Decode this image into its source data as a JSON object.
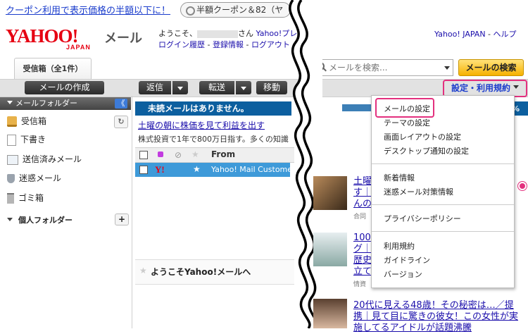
{
  "promo": {
    "link_text": "クーポン利用で表示価格の半額以下に！",
    "coupon_text": "半額クーポン＆82（ヤ"
  },
  "header": {
    "logo_text": "YAHOO!",
    "logo_sub": "JAPAN",
    "service_name": "メール",
    "welcome_prefix": "ようこそ、",
    "welcome_suffix": "さん",
    "yahoo_premium_link": "Yahoo!プレ",
    "login_history": "ログイン履歴",
    "registration_info": "登録情報",
    "logout": "ログアウト",
    "sep": " - ",
    "yahoo_japan_link": "Yahoo! JAPAN",
    "help_link": "ヘルプ"
  },
  "tab": {
    "label": "受信箱（全1件）"
  },
  "search": {
    "placeholder": "メールを検索...",
    "button_label": "メールの検索"
  },
  "toolbar": {
    "compose": "メールの作成",
    "reply": "返信",
    "forward": "転送",
    "move": "移動",
    "settings": "設定・利用規約"
  },
  "sidebar": {
    "header": "メールフォルダー",
    "collapse": "《",
    "refresh": "↻",
    "folders": [
      {
        "label": "受信箱",
        "icon": "inbox-icon"
      },
      {
        "label": "下書き",
        "icon": "draft-icon"
      },
      {
        "label": "送信済みメール",
        "icon": "sent-icon"
      },
      {
        "label": "迷惑メール",
        "icon": "spam-shield-icon"
      },
      {
        "label": "ゴミ箱",
        "icon": "trash-icon"
      }
    ],
    "personal_header": "個人フォルダー",
    "add": "+"
  },
  "main": {
    "notice": "未読メールはありません。",
    "notice_suffix": "%",
    "ad_link": "土曜の朝に株価を見て利益を出す",
    "ad_text": "株式投資で1年で800万日指す。多くの知識",
    "column_from": "From",
    "row": {
      "sender": "Yahoo! Mail Custome",
      "logo": "Y!",
      "star": "★"
    },
    "welcome_title": "ようこそYahoo!メールへ"
  },
  "ads": [
    {
      "line1": "土曜",
      "line2": "す｜",
      "line3": "んの知",
      "src": "合同"
    },
    {
      "line1": "100",
      "line2": "グ｜B",
      "line3": "歴史",
      "line4": "立て",
      "src": "情資"
    },
    {
      "line1": "20代に見える48歳！その秘密は…／提",
      "line2": "携｜見て目に驚きの彼女！この女性が実",
      "line3": "施してるアイドルが話題沸騰"
    }
  ],
  "menu": {
    "items": [
      {
        "label": "メールの設定",
        "highlighted": true
      },
      {
        "label": "テーマの設定"
      },
      {
        "label": "画面レイアウトの設定"
      },
      {
        "label": "デスクトップ通知の設定"
      },
      {
        "label": "新着情報"
      },
      {
        "label": "迷惑メール対策情報"
      },
      {
        "label": "プライバシーポリシー"
      },
      {
        "label": "利用規約"
      },
      {
        "label": "ガイドライン"
      },
      {
        "label": "バージョン"
      }
    ]
  },
  "colors": {
    "brand_red": "#e60012",
    "highlight_pink": "#e3307e",
    "notice_blue": "#0c5f9f",
    "selected_row": "#3e9ad9",
    "search_button": "#f6b100"
  }
}
